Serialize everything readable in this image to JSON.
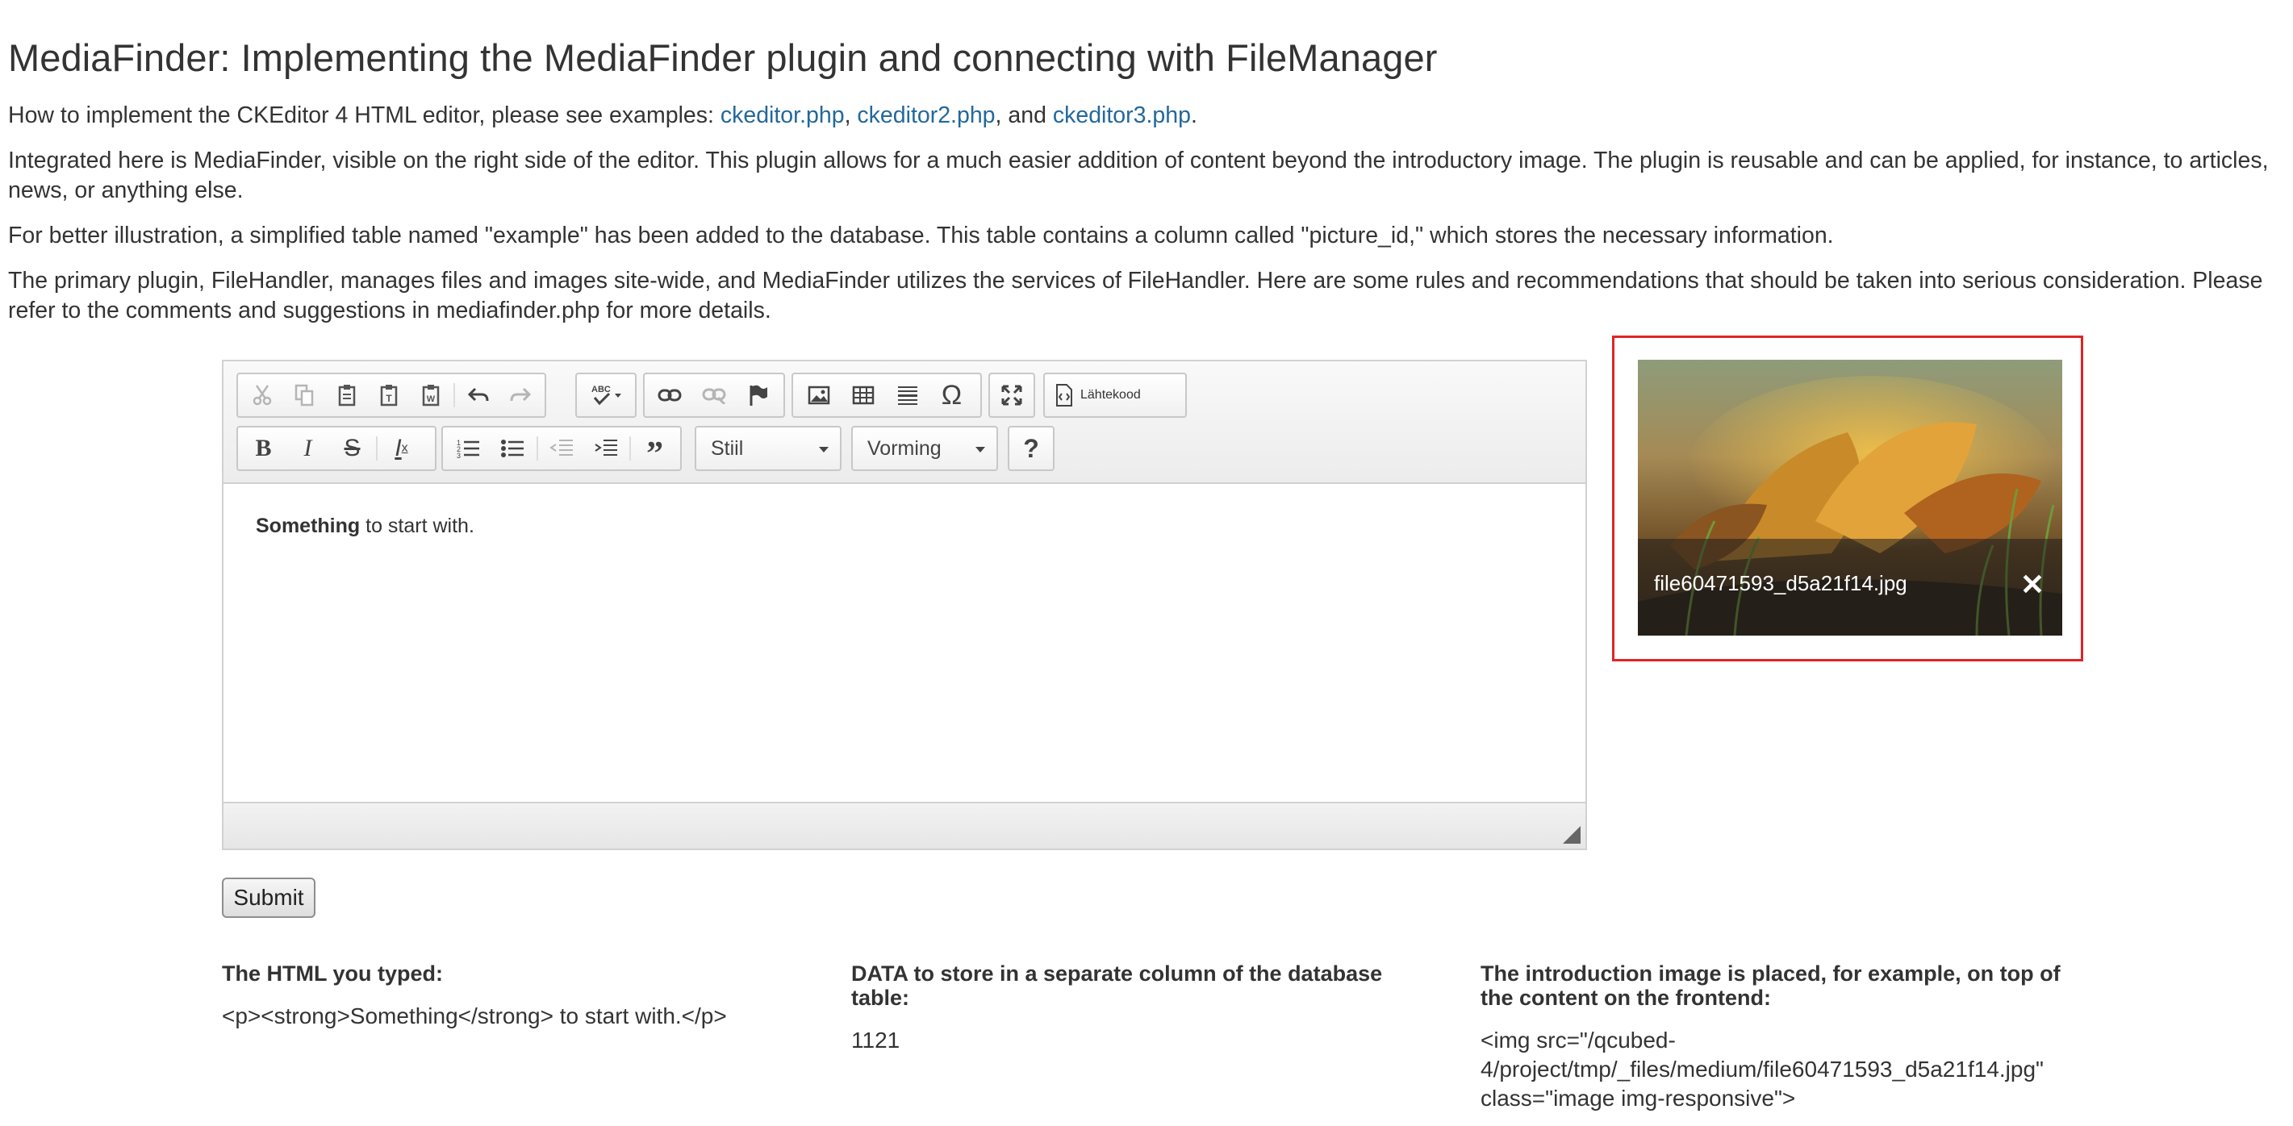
{
  "header": {
    "title": "MediaFinder: Implementing the MediaFinder plugin and connecting with FileManager"
  },
  "intro": {
    "p1_prefix": "How to implement the CKEditor 4 HTML editor, please see examples: ",
    "link1": "ckeditor.php",
    "sep1": ", ",
    "link2": "ckeditor2.php",
    "sep2": ", and ",
    "link3": "ckeditor3.php",
    "end": ".",
    "p2": "Integrated here is MediaFinder, visible on the right side of the editor. This plugin allows for a much easier addition of content beyond the introductory image. The plugin is reusable and can be applied, for instance, to articles, news, or anything else.",
    "p3": "For better illustration, a simplified table named \"example\" has been added to the database. This table contains a column called \"picture_id,\" which stores the necessary information.",
    "p4": "The primary plugin, FileHandler, manages files and images site-wide, and MediaFinder utilizes the services of FileHandler. Here are some rules and recommendations that should be taken into serious consideration. Please refer to the comments and suggestions in mediafinder.php for more details."
  },
  "editor": {
    "source_label": "Lähtekood",
    "styles_label": "Stiil",
    "format_label": "Vorming",
    "help_label": "?",
    "content_bold": "Something",
    "content_rest": " to start with."
  },
  "media": {
    "filename": "file60471593_d5a21f14.jpg",
    "close_label": "✕"
  },
  "form": {
    "submit_label": "Submit"
  },
  "output": {
    "html_heading": "The HTML you typed:",
    "html_value": "<p><strong>Something</strong> to start with.</p>",
    "data_heading": "DATA to store in a separate column of the database table:",
    "data_value": "1121",
    "intro_heading": "The introduction image is placed, for example, on top of the content on the frontend:",
    "intro_value": "<img src=\"/qcubed-4/project/tmp/_files/medium/file60471593_d5a21f14.jpg\" class=\"image img-responsive\">"
  }
}
